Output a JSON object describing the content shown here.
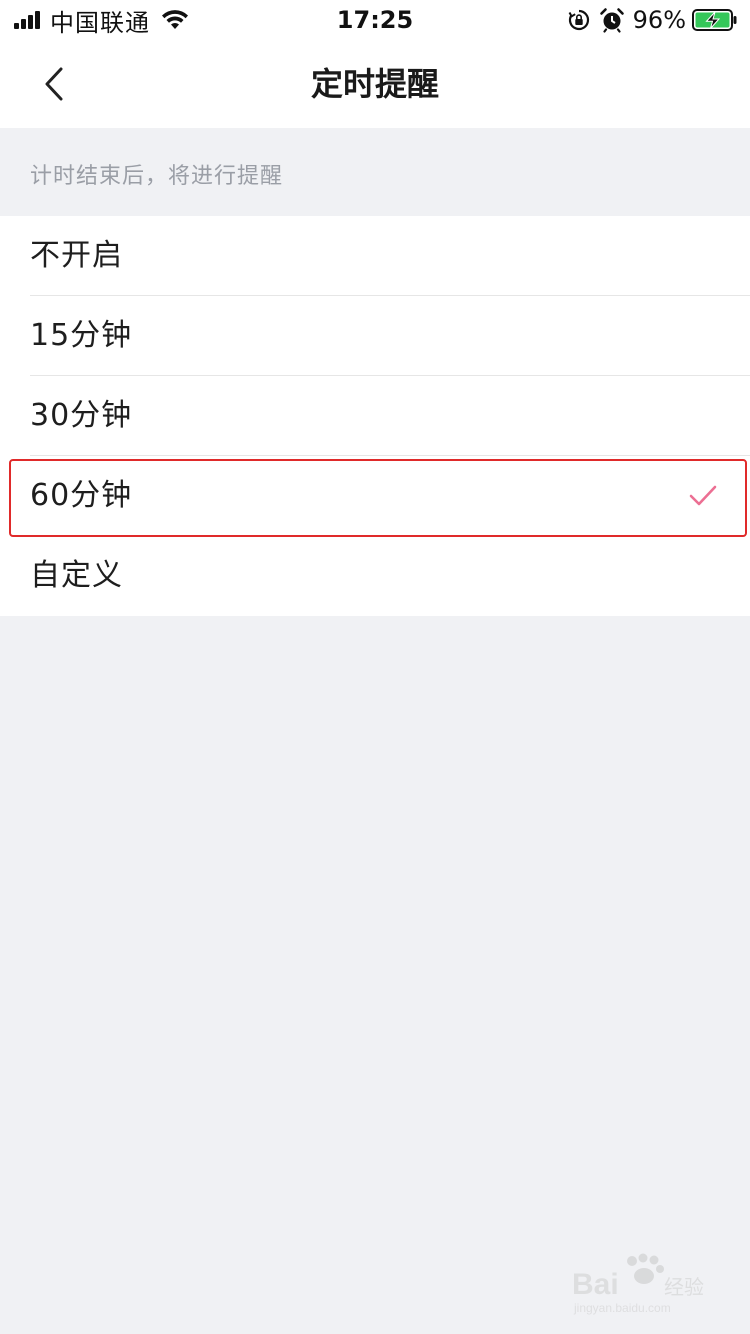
{
  "status_bar": {
    "carrier": "中国联通",
    "time": "17:25",
    "battery_percent": "96%",
    "icons": [
      "signal-icon",
      "wifi-icon",
      "orientation-lock-icon",
      "alarm-icon",
      "battery-charging-icon"
    ]
  },
  "nav": {
    "title": "定时提醒",
    "back_icon": "chevron-left-icon"
  },
  "section": {
    "hint": "计时结束后，将进行提醒"
  },
  "options": [
    {
      "label": "不开启",
      "selected": false
    },
    {
      "label": "15分钟",
      "selected": false
    },
    {
      "label": "30分钟",
      "selected": false
    },
    {
      "label": "60分钟",
      "selected": true
    },
    {
      "label": "自定义",
      "selected": false
    }
  ],
  "colors": {
    "check_mark": "#ec6f93",
    "highlight_border": "#e02a2a",
    "page_background": "#f0f1f4",
    "battery_fill": "#34c759"
  },
  "watermark": {
    "brand": "Bai",
    "brand_cn": "经验",
    "url": "jingyan.baidu.com"
  }
}
